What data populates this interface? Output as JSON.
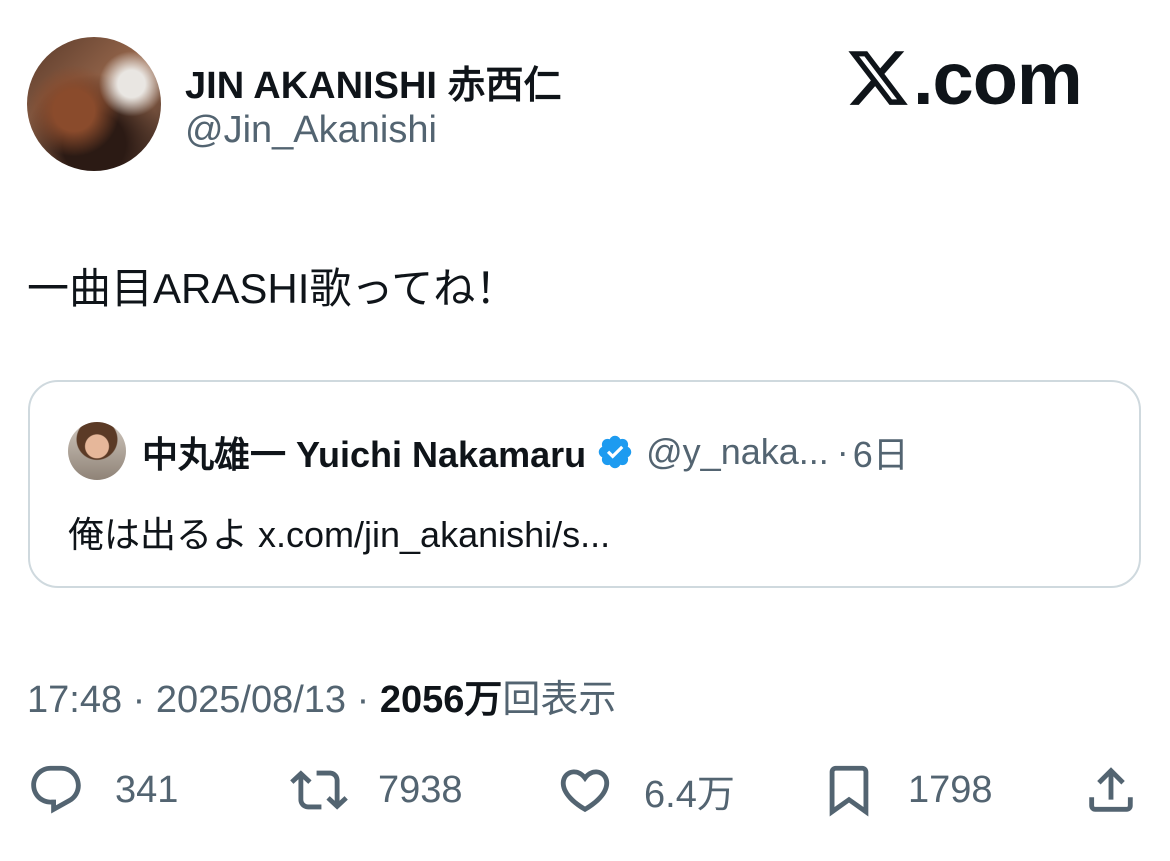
{
  "author": {
    "name": "JIN AKANISHI 赤西仁",
    "handle": "@Jin_Akanishi"
  },
  "brand": {
    "suffix": ".com"
  },
  "tweet": {
    "text": "一曲目ARASHI歌ってね！"
  },
  "quote": {
    "name": "中丸雄一 Yuichi Nakamaru",
    "handle": "@y_naka...",
    "separator": "·",
    "date": "6日",
    "text": "俺は出るよ x.com/jin_akanishi/s..."
  },
  "meta": {
    "time": "17:48",
    "sep1": " · ",
    "date": "2025/08/13",
    "sep2": " · ",
    "views_number": "2056万",
    "views_label": "回表示"
  },
  "actions": {
    "reply": {
      "icon": "reply-icon",
      "count": "341"
    },
    "repost": {
      "icon": "repost-icon",
      "count": "7938"
    },
    "like": {
      "icon": "heart-icon",
      "count": "6.4万"
    },
    "bookmark": {
      "icon": "bookmark-icon",
      "count": "1798"
    },
    "share": {
      "icon": "share-icon"
    }
  },
  "colors": {
    "text_primary": "#0f1419",
    "text_secondary": "#536471",
    "border": "#cfd9de",
    "verified_blue": "#1d9bf0"
  }
}
